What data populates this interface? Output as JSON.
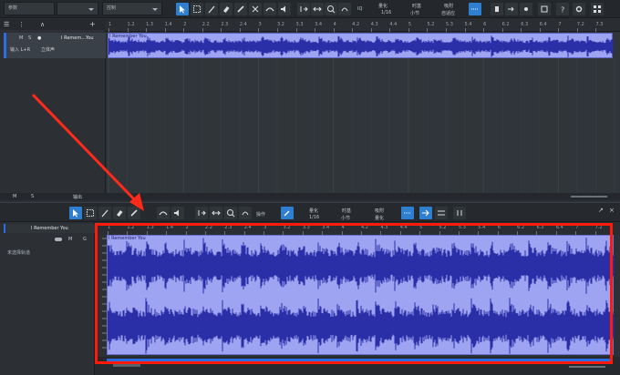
{
  "toolbar": {
    "input_label": "参数",
    "control_label": "控制",
    "quantize_label": "量化",
    "quantize_value": "1/16",
    "timebase_label": "时基",
    "timebase_value": "小节",
    "snap_label": "吸附",
    "snap_value": "自适应",
    "iq_label": "IQ"
  },
  "track": {
    "name": "I Remem...You",
    "mute": "M",
    "solo": "S",
    "input": "输入 L+R",
    "output": "立体声",
    "bottom_m": "M",
    "bottom_s": "S",
    "bottom_label": "输出"
  },
  "ruler_top": [
    "1",
    "1.2",
    "1.3",
    "1.4",
    "2",
    "2.2",
    "2.3",
    "2.4",
    "3",
    "3.2",
    "3.3",
    "3.4",
    "4",
    "4.2",
    "4.3",
    "4.4",
    "5",
    "5.2",
    "5.3",
    "5.4",
    "6",
    "6.2",
    "6.3",
    "6.4",
    "7",
    "7.2",
    "7.3"
  ],
  "clip_title": "I Remember You",
  "editor": {
    "track_name": "I Remember You",
    "m": "M",
    "g": "G",
    "no_selection": "未选择轨道",
    "action_label": "操作",
    "quantize_label": "量化",
    "quantize_value": "1/16",
    "timebase_label": "时基",
    "timebase_value": "小节",
    "snap_label": "吸附",
    "snap_value": "量化",
    "clip_title": "I Remember You"
  },
  "ruler_bottom": [
    "1",
    "1.2",
    "1.3",
    "1.4",
    "2",
    "2.2",
    "2.3",
    "2.4",
    "3",
    "3.2",
    "3.3",
    "3.4",
    "4",
    "4.2",
    "4.3",
    "4.4",
    "5",
    "5.2",
    "5.3",
    "5.4",
    "6",
    "6.2",
    "6.3",
    "6.4",
    "7",
    "7.2"
  ],
  "colors": {
    "accent": "#2f7fd0",
    "waveform_bg": "#9ea3f2",
    "waveform_fg": "#2a2fa8",
    "highlight": "#ff1a0a",
    "arrow": "#ff2a1a"
  }
}
